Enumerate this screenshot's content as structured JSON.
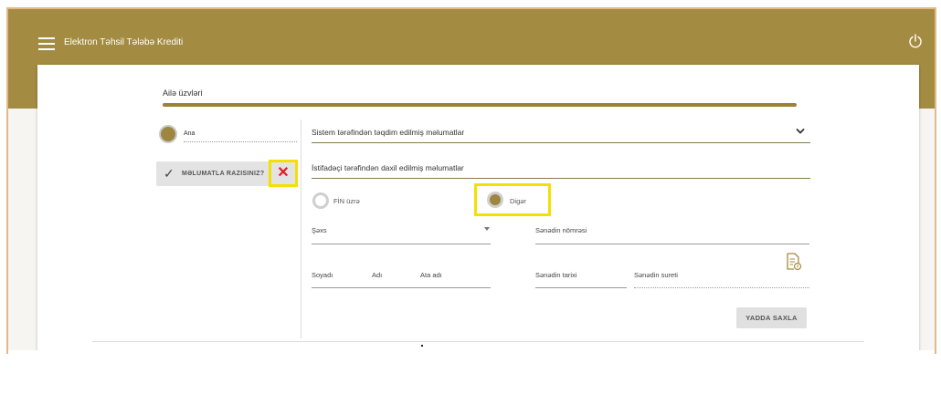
{
  "header": {
    "app_title": "Elektron Təhsil Tələbə Krediti",
    "menu_icon": "hamburger-menu-icon",
    "power_icon": "power-icon"
  },
  "family": {
    "section_title": "Ailə üzvləri",
    "member_name": "Ana",
    "consent_label": "MƏLUMATLA RAZISINIZ?",
    "check_icon": "check-icon",
    "reject_icon": "close-x-icon"
  },
  "system_info": {
    "title": "Sistem tərəfindən təqdim edilmiş məlumatlar",
    "expand_icon": "chevron-down-icon"
  },
  "user_info": {
    "title": "İstifadəçi tərəfindən daxil edilmiş məlumatlar",
    "option_fin": "FİN üzrə",
    "option_other": "Digər",
    "selected_option": "Digər",
    "person_label": "Şəxs",
    "doc_number_label": "Sənədin nömrəsi",
    "surname_label": "Soyadı",
    "name_label": "Adı",
    "father_name_label": "Ata adı",
    "doc_date_label": "Sənədin tarixi",
    "doc_copy_label": "Sənədin sureti",
    "upload_icon": "document-upload-icon",
    "save_label": "YADDA SAXLA"
  },
  "colors": {
    "brand": "#a48b42",
    "highlight": "#f4e000",
    "reject": "#e31b23"
  }
}
